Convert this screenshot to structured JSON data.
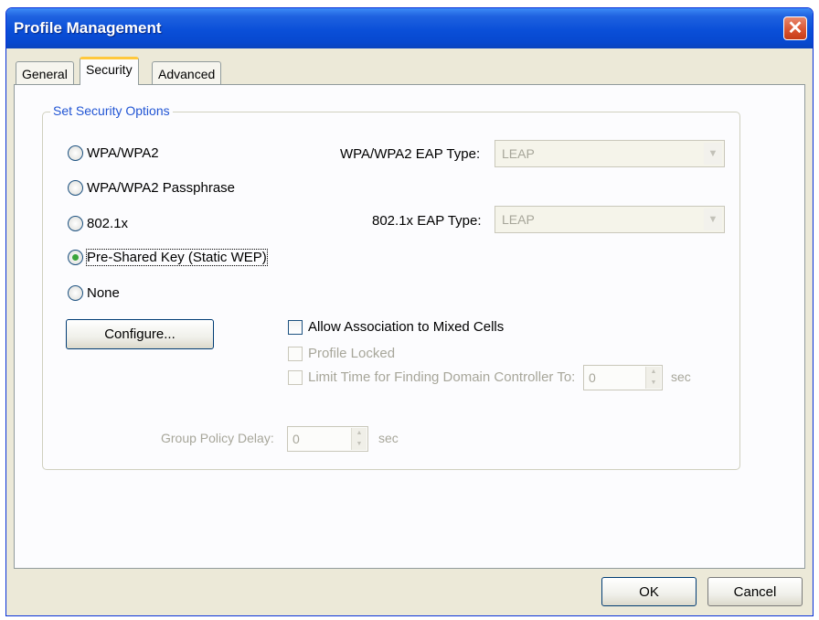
{
  "window": {
    "title": "Profile Management",
    "close_glyph": "✕"
  },
  "tabs": [
    {
      "label": "General"
    },
    {
      "label": "Security"
    },
    {
      "label": "Advanced"
    }
  ],
  "group": {
    "label": "Set Security Options"
  },
  "options": [
    {
      "label": "WPA/WPA2",
      "selected": false
    },
    {
      "label": "WPA/WPA2 Passphrase",
      "selected": false
    },
    {
      "label": "802.1x",
      "selected": false
    },
    {
      "label": "Pre-Shared Key (Static WEP)",
      "selected": true
    },
    {
      "label": "None",
      "selected": false
    }
  ],
  "wpa_eap": {
    "label": "WPA/WPA2 EAP Type:",
    "value": "LEAP"
  },
  "dot1x_eap": {
    "label": "802.1x EAP Type:",
    "value": "LEAP"
  },
  "configure_button": "Configure...",
  "allow_mixed": {
    "label": "Allow Association to Mixed Cells",
    "checked": false
  },
  "profile_locked": {
    "label": "Profile Locked",
    "checked": false
  },
  "limit_time": {
    "label": "Limit Time for Finding Domain Controller To:",
    "value": "0",
    "unit": "sec"
  },
  "group_policy": {
    "label": "Group Policy Delay:",
    "value": "0",
    "unit": "sec"
  },
  "footer": {
    "ok": "OK",
    "cancel": "Cancel"
  },
  "icons": {
    "spin_up": "▲",
    "spin_down": "▼",
    "dropdown": "▼"
  },
  "colors": {
    "titlebar": "#0a4fd8",
    "group_label": "#2155d4",
    "tab_highlight": "#ffc83c"
  }
}
